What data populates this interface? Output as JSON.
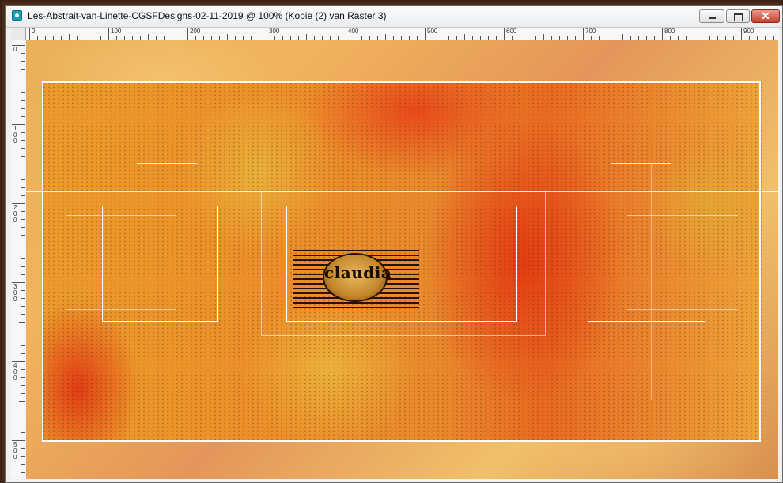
{
  "window": {
    "title": "Les-Abstrait-van-Linette-CGSFDesigns-02-11-2019 @ 100% (Kopie (2) van Raster 3)",
    "minimize_label": "",
    "maximize_label": "",
    "close_label": "✕"
  },
  "ruler": {
    "horizontal_labels": [
      "0",
      "100",
      "200",
      "300",
      "400",
      "500",
      "600",
      "700",
      "800",
      "900"
    ],
    "vertical_labels": [
      "0",
      "1\n0\n0",
      "2\n0\n0",
      "3\n0\n0",
      "4\n0\n0",
      "5\n0\n0"
    ]
  },
  "canvas": {
    "logo_text": "claudia",
    "colors": {
      "outer_frame": "#3a2316",
      "accent_orange": "#ec9b2b",
      "accent_red": "#e33d12",
      "frame_line": "#ffffff"
    }
  }
}
